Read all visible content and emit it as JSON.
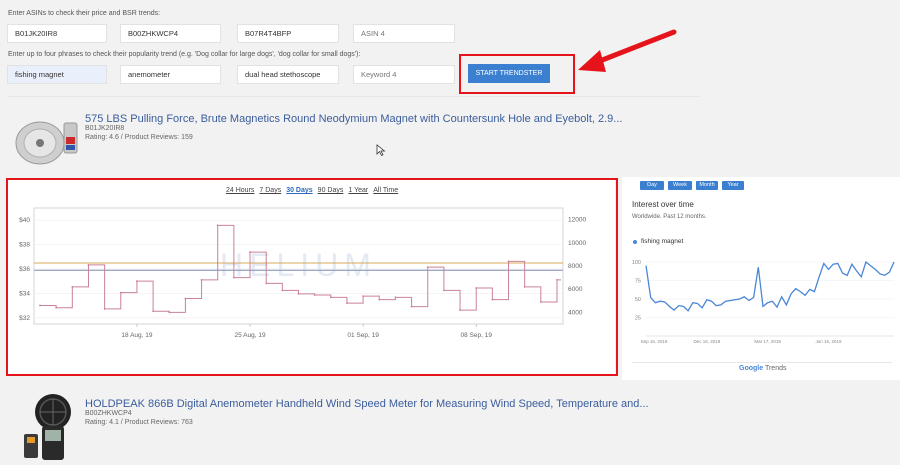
{
  "asin_section": {
    "label": "Enter ASINs to check their price and BSR trends:",
    "inputs": [
      {
        "value": "B01JK20IR8",
        "placeholder": ""
      },
      {
        "value": "B00ZHKWCP4",
        "placeholder": ""
      },
      {
        "value": "B07R4T4BFP",
        "placeholder": ""
      },
      {
        "value": "",
        "placeholder": "ASIN 4"
      }
    ]
  },
  "phrase_section": {
    "label": "Enter up to four phrases to check their popularity trend (e.g. 'Dog collar for large dogs', 'dog collar for small dogs'):",
    "inputs": [
      {
        "value": "fishing magnet",
        "placeholder": ""
      },
      {
        "value": "anemometer",
        "placeholder": ""
      },
      {
        "value": "dual head stethoscope",
        "placeholder": ""
      },
      {
        "value": "",
        "placeholder": "Keyword 4"
      }
    ],
    "start_button": "START TRENDSTER"
  },
  "products": [
    {
      "title": "575 LBS Pulling Force, Brute Magnetics Round Neodymium Magnet with Countersunk Hole and Eyebolt, 2.9...",
      "asin": "B01JK20IR8",
      "rating": "Rating: 4.6 / Product Reviews: 159"
    },
    {
      "title": "HOLDPEAK 866B Digital Anemometer Handheld Wind Speed Meter for Measuring Wind Speed, Temperature and...",
      "asin": "B00ZHKWCP4",
      "rating": "Rating: 4.1 / Product Reviews: 763"
    }
  ],
  "price_chart": {
    "ranges": [
      "24 Hours",
      "7 Days",
      "30 Days",
      "90 Days",
      "1 Year",
      "All Time"
    ],
    "active_range": "30 Days",
    "y_left_ticks": [
      "$40",
      "$38",
      "$36",
      "$34",
      "$32"
    ],
    "y_right_ticks": [
      "12000",
      "10000",
      "8000",
      "6000",
      "4000"
    ],
    "x_ticks": [
      "18 Aug, 19",
      "25 Aug, 19",
      "01 Sep, 19",
      "08 Sep, 19"
    ],
    "watermark": "HELIUM"
  },
  "trends_panel": {
    "buttons": [
      "Day",
      "Week",
      "Month",
      "Year"
    ],
    "title": "Interest over time",
    "subtitle": "Worldwide. Past 12 months.",
    "legend": "fishing magnet",
    "y_ticks": [
      "100",
      "75",
      "50",
      "25"
    ],
    "x_ticks": [
      "Sep 16, 2018",
      "Dec 16, 2018",
      "Mar 17, 2019",
      "Jun 16, 2019"
    ],
    "footer_brand": "Google",
    "footer_product": "Trends"
  },
  "chart_data": [
    {
      "type": "line",
      "title": "",
      "xlabel": "",
      "ylabel": "",
      "x": [
        "Aug 12",
        "Aug 13",
        "Aug 14",
        "Aug 15",
        "Aug 16",
        "Aug 17",
        "Aug 18",
        "Aug 19",
        "Aug 20",
        "Aug 21",
        "Aug 22",
        "Aug 23",
        "Aug 24",
        "Aug 25",
        "Aug 26",
        "Aug 27",
        "Aug 28",
        "Aug 29",
        "Aug 30",
        "Aug 31",
        "Sep 01",
        "Sep 02",
        "Sep 03",
        "Sep 04",
        "Sep 05",
        "Sep 06",
        "Sep 07",
        "Sep 08",
        "Sep 09",
        "Sep 10",
        "Sep 11",
        "Sep 12",
        "Sep 13"
      ],
      "series": [
        {
          "values": [
            4600,
            4400,
            6200,
            8100,
            4300,
            5700,
            6700,
            4100,
            4000,
            5200,
            6800,
            11500,
            7000,
            9200,
            6500,
            5900,
            5600,
            5500,
            5300,
            4800,
            5400,
            5100,
            5300,
            4500,
            7900,
            5900,
            4200,
            6100,
            5100,
            8400,
            6200,
            4900,
            6800
          ]
        }
      ],
      "y_right_range": [
        3000,
        13000
      ],
      "reference_lines": [
        {
          "axis": "left",
          "value": 36.5,
          "color": "#d9a85a"
        },
        {
          "axis": "left",
          "value": 35.9,
          "color": "#7d8fb5"
        }
      ],
      "ylim_left": [
        31.5,
        41
      ],
      "grid": true
    },
    {
      "type": "line",
      "title": "Interest over time",
      "series": [
        {
          "name": "fishing magnet",
          "values": [
            95,
            52,
            45,
            47,
            46,
            40,
            35,
            41,
            40,
            34,
            45,
            44,
            38,
            49,
            47,
            41,
            42,
            47,
            48,
            49,
            50,
            53,
            48,
            52,
            93,
            40,
            45,
            47,
            39,
            53,
            42,
            57,
            64,
            60,
            55,
            63,
            60,
            80,
            98,
            90,
            97,
            98,
            85,
            82,
            97,
            88,
            80,
            100,
            95,
            90,
            84,
            82,
            86,
            100
          ]
        }
      ],
      "x_ticks": [
        "Sep 16, 2018",
        "Dec 16, 2018",
        "Mar 17, 2019",
        "Jun 16, 2019"
      ],
      "ylim": [
        0,
        100
      ],
      "legend": "top-left"
    }
  ]
}
